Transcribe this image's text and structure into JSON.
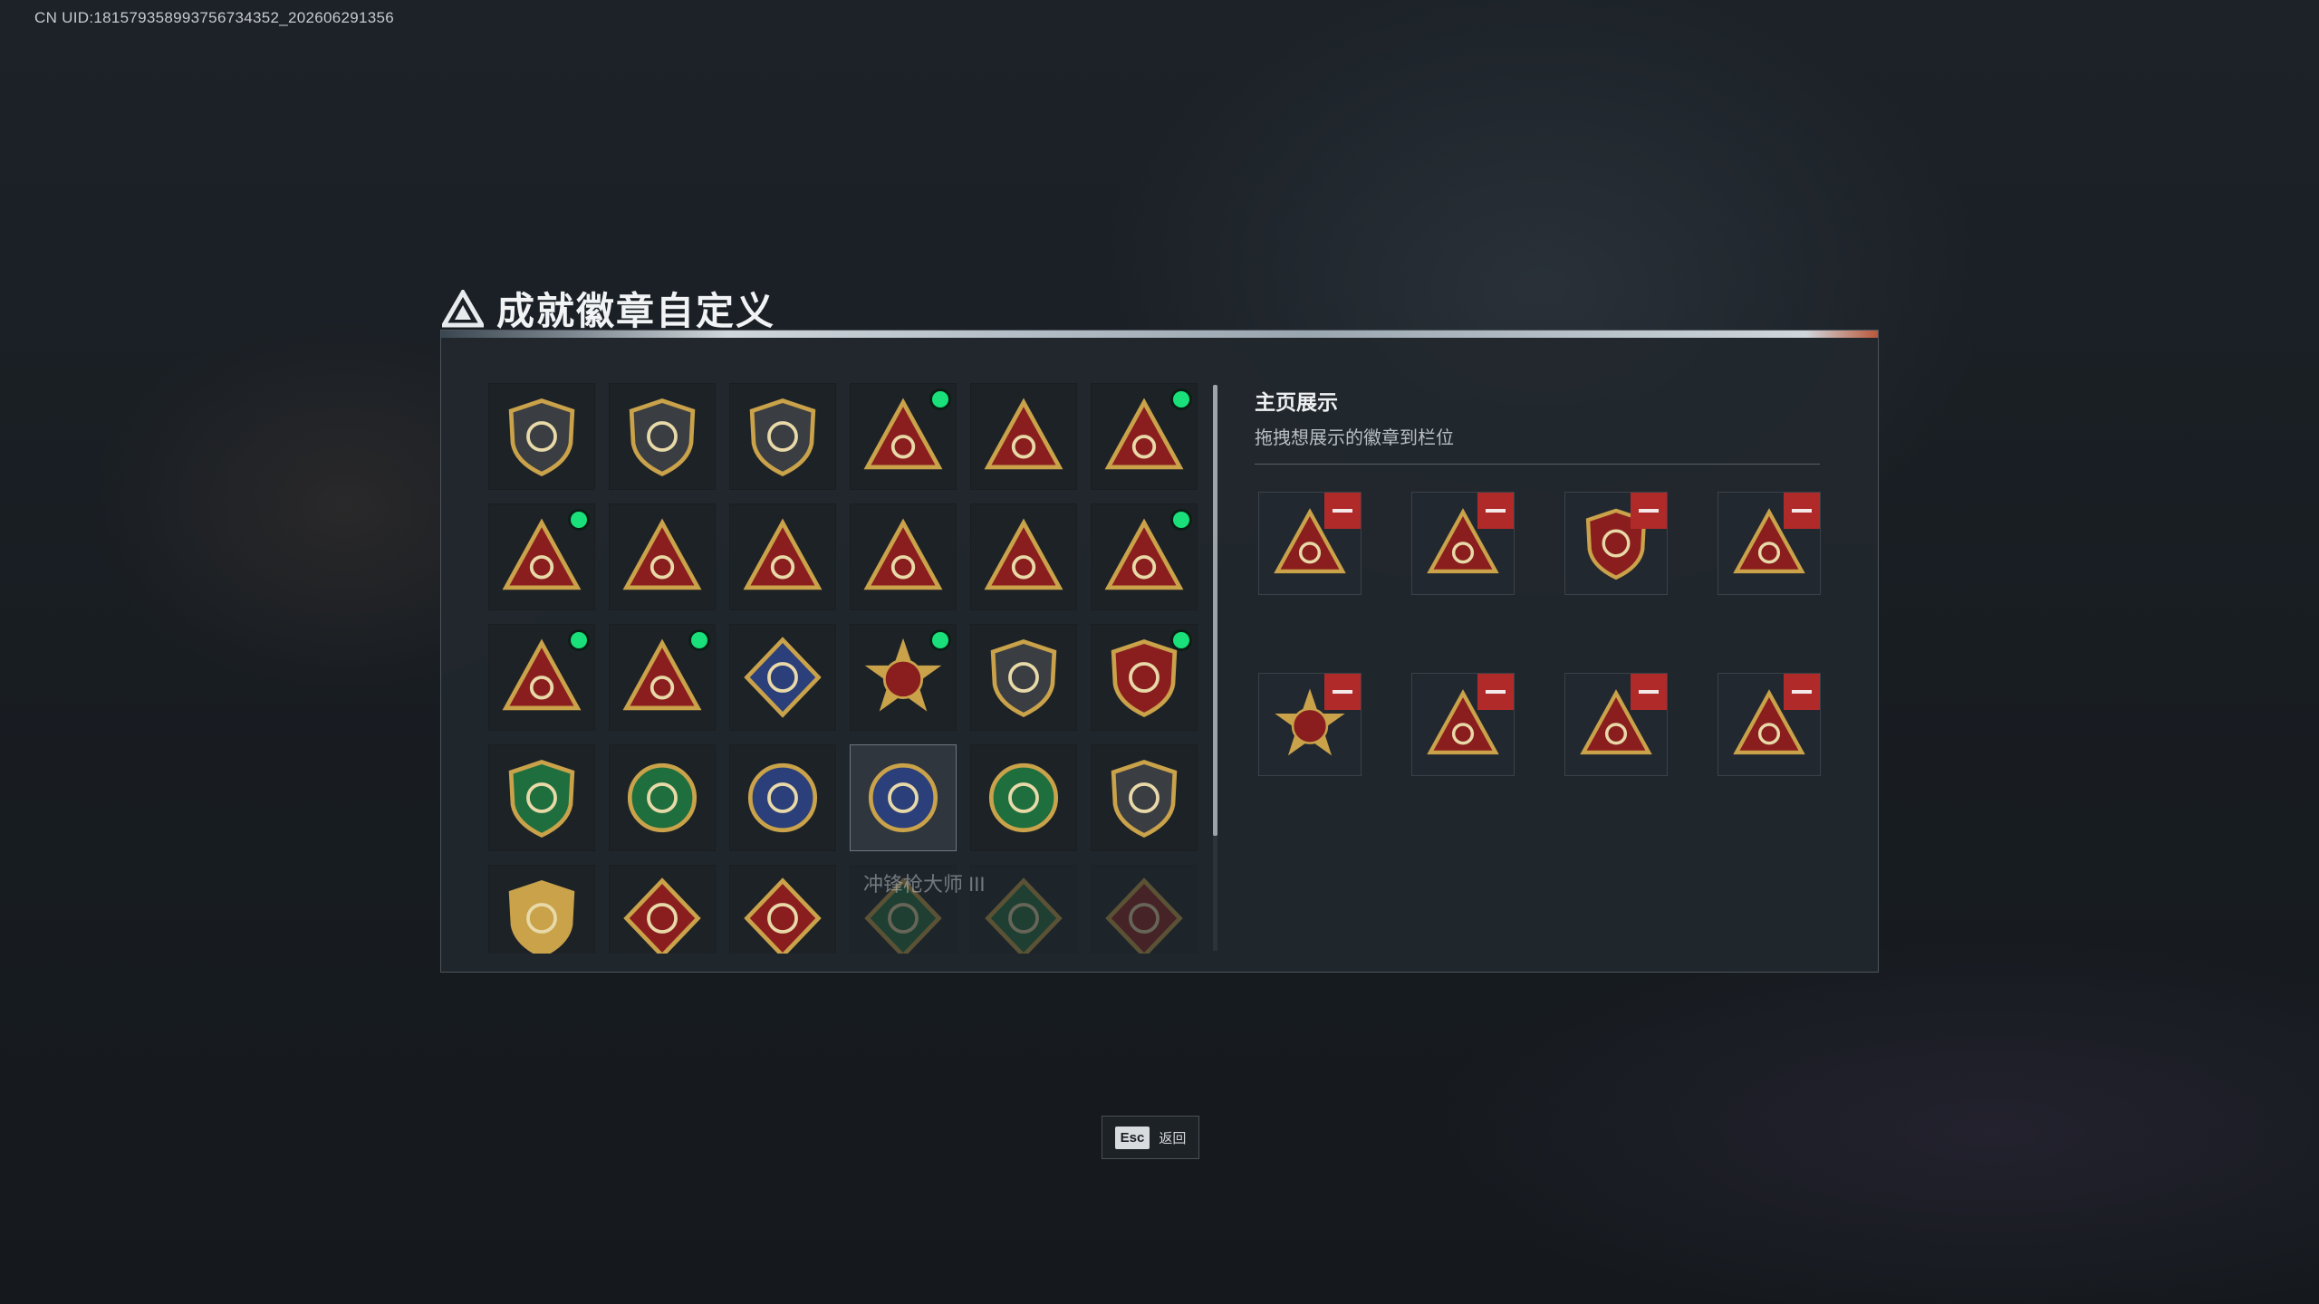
{
  "uid_text": "CN UID:18157935899375673435​2_202606291356",
  "title": "成就徽章自定义",
  "title_tiny": "",
  "colors": {
    "gold": "#c9a24a",
    "red": "#8a1e1e",
    "green": "#1f6e3e",
    "blue": "#2b3f7a",
    "dark": "#3a3d42",
    "dot": "#19e07a",
    "remove": "#b12a2a"
  },
  "badges": [
    {
      "shape": "shield",
      "color": "dark",
      "icon": "rank-a-icon",
      "dot": false
    },
    {
      "shape": "shield",
      "color": "dark",
      "icon": "helicopter-icon",
      "dot": false
    },
    {
      "shape": "shield",
      "color": "dark",
      "icon": "jet-icon",
      "dot": false
    },
    {
      "shape": "triangle",
      "color": "red",
      "icon": "eye-icon",
      "dot": true
    },
    {
      "shape": "triangle",
      "color": "red",
      "icon": "s4-icon",
      "dot": false
    },
    {
      "shape": "triangle",
      "color": "red",
      "icon": "s7-icon",
      "dot": true
    },
    {
      "shape": "triangle",
      "color": "red",
      "icon": "s8-icon",
      "dot": true
    },
    {
      "shape": "triangle",
      "color": "red",
      "icon": "soldier-icon",
      "dot": false
    },
    {
      "shape": "triangle",
      "color": "red",
      "icon": "figure-icon",
      "dot": false
    },
    {
      "shape": "triangle",
      "color": "red",
      "icon": "boat-icon",
      "dot": false
    },
    {
      "shape": "triangle",
      "color": "red",
      "icon": "number-one-icon",
      "dot": false
    },
    {
      "shape": "triangle",
      "color": "red",
      "icon": "bottle-icon",
      "dot": true
    },
    {
      "shape": "triangle",
      "color": "red",
      "icon": "squad-icon",
      "dot": true
    },
    {
      "shape": "triangle",
      "color": "red",
      "icon": "rocket-icon",
      "dot": true
    },
    {
      "shape": "diamond",
      "color": "blue",
      "icon": "cube-icon",
      "dot": false
    },
    {
      "shape": "star-circle",
      "color": "red",
      "icon": "star-skull-icon",
      "dot": true
    },
    {
      "shape": "shield",
      "color": "dark",
      "icon": "emblem-icon",
      "dot": false
    },
    {
      "shape": "shield",
      "color": "red",
      "icon": "crest-icon",
      "dot": true
    },
    {
      "shape": "shield",
      "color": "green",
      "icon": "wreath-icon",
      "dot": false
    },
    {
      "shape": "circle",
      "color": "green",
      "icon": "flower-icon",
      "dot": false
    },
    {
      "shape": "circle",
      "color": "blue",
      "icon": "crosshair-rifle-icon",
      "dot": false
    },
    {
      "shape": "circle",
      "color": "blue",
      "icon": "crosshair-rifle-icon",
      "dot": false
    },
    {
      "shape": "circle",
      "color": "green",
      "icon": "crosshair-rifle-icon",
      "dot": false
    },
    {
      "shape": "shield",
      "color": "dark",
      "icon": "target-icon",
      "dot": false
    },
    {
      "shape": "shield",
      "color": "gold",
      "icon": "cross-weapons-icon",
      "dot": false
    },
    {
      "shape": "diamond",
      "color": "red",
      "icon": "wolf-icon",
      "dot": false
    },
    {
      "shape": "diamond",
      "color": "red",
      "icon": "wolf-icon",
      "dot": false
    },
    {
      "shape": "diamond",
      "color": "green",
      "icon": "rifle-icon",
      "dot": false
    },
    {
      "shape": "diamond",
      "color": "green",
      "icon": "rifle-icon",
      "dot": false
    },
    {
      "shape": "diamond",
      "color": "red",
      "icon": "wolf-icon",
      "dot": false
    }
  ],
  "selected_index": 21,
  "tooltip": {
    "name": "冲锋枪大师 III",
    "sub": "",
    "desc": ""
  },
  "right": {
    "heading": "主页展示",
    "subheading": "拖拽想展示的徽章到栏位"
  },
  "slots": [
    {
      "shape": "triangle",
      "color": "red",
      "icon": "bottle-icon"
    },
    {
      "shape": "triangle",
      "color": "red",
      "icon": "squad-icon"
    },
    {
      "shape": "shield",
      "color": "red",
      "icon": "crest-icon"
    },
    {
      "shape": "triangle",
      "color": "red",
      "icon": "eye-icon"
    },
    {
      "shape": "star-circle",
      "color": "red",
      "icon": "star-skull-icon"
    },
    {
      "shape": "triangle",
      "color": "red",
      "icon": "s7-icon"
    },
    {
      "shape": "triangle",
      "color": "red",
      "icon": "s8-icon"
    },
    {
      "shape": "triangle",
      "color": "red",
      "icon": "rocket-icon"
    }
  ],
  "esc": {
    "key": "Esc",
    "label": "返回"
  }
}
